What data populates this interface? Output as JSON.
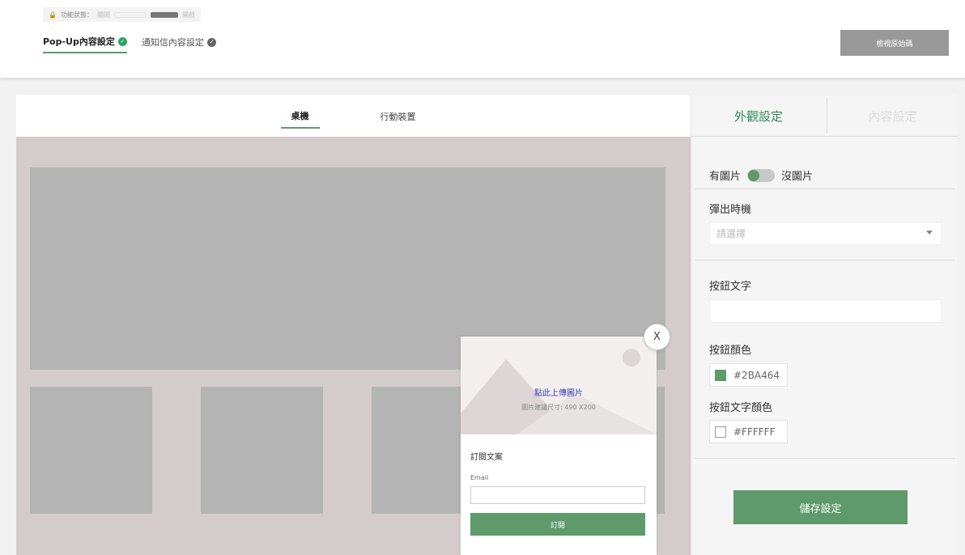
{
  "header": {
    "status": {
      "label": "功能狀態：",
      "off_label": "關閉",
      "on_label": "開啟"
    },
    "tabs": [
      {
        "label": "Pop-Up內容設定"
      },
      {
        "label": "通知信內容設定"
      }
    ],
    "view_source_label": "檢視原始碼"
  },
  "preview": {
    "device_tabs": [
      {
        "label": "桌機"
      },
      {
        "label": "行動裝置"
      }
    ],
    "popup": {
      "upload_label": "點此上傳圖片",
      "size_hint": "圖片建議尺寸: 490 X200",
      "title": "訂閱文案",
      "email_label": "Email",
      "subscribe_label": "訂閱",
      "close_label": "X"
    }
  },
  "settings": {
    "tabs": [
      {
        "label": "外觀設定"
      },
      {
        "label": "內容設定"
      }
    ],
    "image_toggle": {
      "on_label": "有圖片",
      "off_label": "沒圖片"
    },
    "trigger": {
      "label": "彈出時機",
      "placeholder": "請選擇"
    },
    "button_text": {
      "label": "按鈕文字",
      "value": ""
    },
    "button_color": {
      "label": "按鈕顏色",
      "value": "#2BA464",
      "swatch": "#5e9a6a"
    },
    "button_text_color": {
      "label": "按鈕文字顏色",
      "value": "#FFFFFF",
      "swatch": "#ffffff"
    },
    "save_label": "儲存設定"
  },
  "colors": {
    "accent": "#5e9a6a",
    "accent_text": "#2e8b55"
  }
}
